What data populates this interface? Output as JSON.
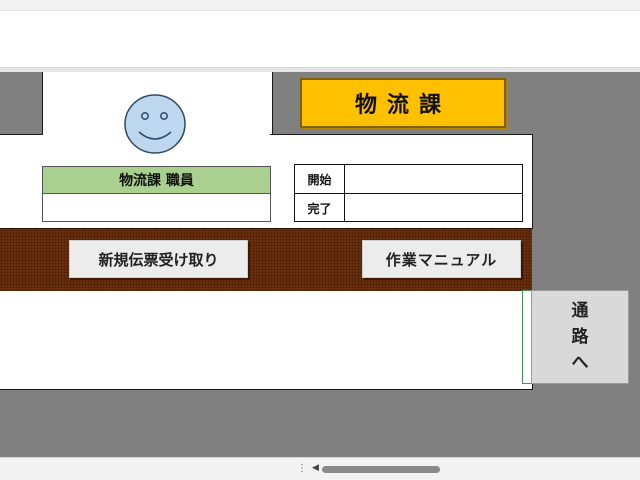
{
  "department_title": "物流課",
  "staff_label": "物流課 職員",
  "staff_name": "",
  "time_table": {
    "start_label": "開始",
    "start_value": "",
    "finish_label": "完了",
    "finish_value": ""
  },
  "buttons": {
    "new_slip": "新規伝票受け取り",
    "work_manual": "作業マニュアル"
  },
  "passage": {
    "line1": "通",
    "line2": "路",
    "line3": "へ"
  },
  "horizontal_scroll_fraction": 0.0,
  "colors": {
    "floor": "#808080",
    "title_fill": "#ffc000",
    "staff_header": "#a9d08e",
    "counter": "#6b3010",
    "face": "#bdd7ee"
  }
}
